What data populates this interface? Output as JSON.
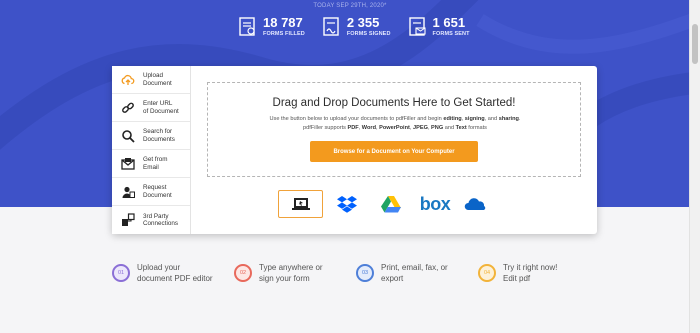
{
  "header": {
    "date_line": "TODAY SEP 29TH, 2020*",
    "stats": [
      {
        "number": "18 787",
        "label": "FORMS FILLED",
        "icon": "form-filled-icon"
      },
      {
        "number": "2 355",
        "label": "FORMS SIGNED",
        "icon": "form-signed-icon"
      },
      {
        "number": "1 651",
        "label": "FORMS SENT",
        "icon": "form-sent-icon"
      }
    ]
  },
  "sidebar": {
    "items": [
      {
        "label": "Upload\nDocument",
        "icon": "cloud-upload-icon"
      },
      {
        "label": "Enter URL\nof Document",
        "icon": "link-icon"
      },
      {
        "label": "Search for\nDocuments",
        "icon": "search-icon"
      },
      {
        "label": "Get from\nEmail",
        "icon": "email-icon"
      },
      {
        "label": "Request\nDocument",
        "icon": "request-document-icon"
      },
      {
        "label": "3rd Party\nConnections",
        "icon": "connections-icon"
      }
    ]
  },
  "upload": {
    "title": "Drag and Drop Documents Here to Get Started!",
    "sub_1": "Use the button below to upload your documents to pdfFiller and begin",
    "sub_editing": "editing",
    "sub_signing": "signing",
    "sub_and": "and",
    "sub_sharing": "sharing",
    "sub_2": "pdfFiller supports",
    "fmt_pdf": "PDF",
    "fmt_word": "Word",
    "fmt_ppt": "PowerPoint",
    "fmt_jpeg": "JPEG",
    "fmt_png": "PNG",
    "fmt_text": "Text",
    "sub_formats": "formats",
    "browse_label": "Browse for a Document on Your Computer"
  },
  "sources": [
    {
      "icon": "computer-icon"
    },
    {
      "icon": "dropbox-icon"
    },
    {
      "icon": "google-drive-icon"
    },
    {
      "label": "box",
      "icon": "box-icon"
    },
    {
      "icon": "onedrive-icon"
    }
  ],
  "steps": [
    {
      "num": "01",
      "text": "Upload your\ndocument PDF editor",
      "color": "#8b6fd6",
      "bg": "#ece7fb"
    },
    {
      "num": "02",
      "text": "Type anywhere or\nsign your form",
      "color": "#e8695c",
      "bg": "#fde7e4"
    },
    {
      "num": "03",
      "text": "Print, email, fax, or\nexport",
      "color": "#4e7fd8",
      "bg": "#e4ecfb"
    },
    {
      "num": "04",
      "text": "Try it right now!\nEdit pdf",
      "color": "#f2b33a",
      "bg": "#fdf1d8"
    }
  ],
  "colors": {
    "hero": "#3e52c8",
    "accent": "#f39a1e"
  }
}
